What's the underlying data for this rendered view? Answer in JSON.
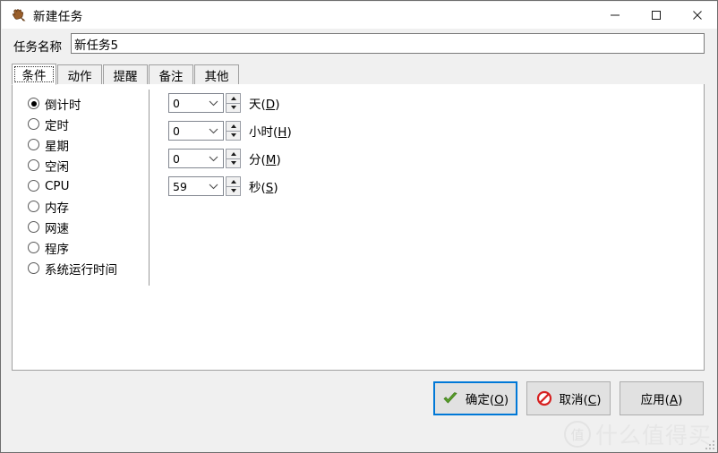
{
  "window": {
    "title": "新建任务",
    "icon": "hand-cursor-icon",
    "controls": {
      "minimize": "minimize-icon",
      "maximize": "maximize-icon",
      "close": "close-icon"
    }
  },
  "form": {
    "name_label": "任务名称",
    "name_value": "新任务5",
    "name_placeholder": ""
  },
  "tabs": [
    {
      "label": "条件",
      "selected": true
    },
    {
      "label": "动作",
      "selected": false
    },
    {
      "label": "提醒",
      "selected": false
    },
    {
      "label": "备注",
      "selected": false
    },
    {
      "label": "其他",
      "selected": false
    }
  ],
  "conditions": {
    "options": [
      {
        "label": "倒计时",
        "checked": true
      },
      {
        "label": "定时",
        "checked": false
      },
      {
        "label": "星期",
        "checked": false
      },
      {
        "label": "空闲",
        "checked": false
      },
      {
        "label": "CPU",
        "checked": false
      },
      {
        "label": "内存",
        "checked": false
      },
      {
        "label": "网速",
        "checked": false
      },
      {
        "label": "程序",
        "checked": false
      },
      {
        "label": "系统运行时间",
        "checked": false
      }
    ],
    "countdown": [
      {
        "value": "0",
        "unit": "天",
        "mnemonic": "D"
      },
      {
        "value": "0",
        "unit": "小时",
        "mnemonic": "H"
      },
      {
        "value": "0",
        "unit": "分",
        "mnemonic": "M"
      },
      {
        "value": "59",
        "unit": "秒",
        "mnemonic": "S"
      }
    ]
  },
  "footer": {
    "ok": {
      "text": "确定",
      "mnemonic": "O",
      "icon": "green-check-icon",
      "default": true
    },
    "cancel": {
      "text": "取消",
      "mnemonic": "C",
      "icon": "red-prohibition-icon"
    },
    "apply": {
      "text": "应用",
      "mnemonic": "A",
      "icon": "none"
    }
  },
  "watermark": {
    "logo_char": "值",
    "text": "什么值得买"
  },
  "colors": {
    "dialog_bg": "#f0f0f0",
    "panel_bg": "#ffffff",
    "accent_focus": "#0078d7",
    "check_green": "#5aa02c",
    "prohibition_red": "#d62121",
    "watermark_gray": "#e6e6e6"
  }
}
